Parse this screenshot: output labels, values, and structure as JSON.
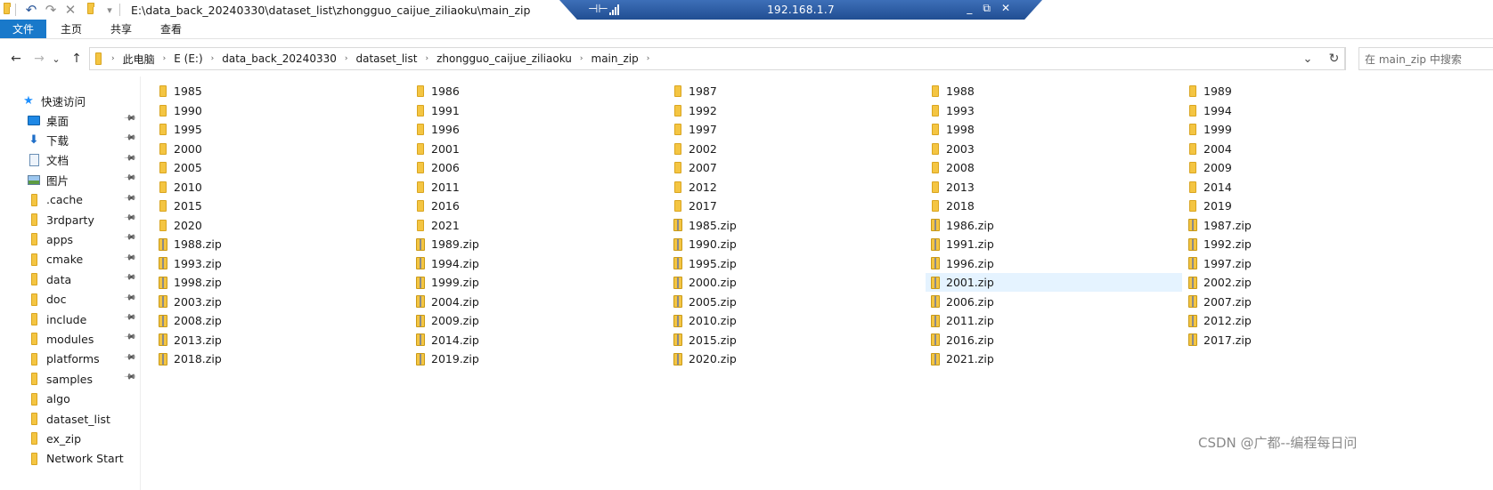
{
  "titlebar": {
    "path": "E:\\data_back_20240330\\dataset_list\\zhongguo_caijue_ziliaoku\\main_zip",
    "dropdown_glyph": "▾"
  },
  "remote": {
    "ip": "192.168.1.7",
    "pin_glyph": "⊣⊢",
    "controls": [
      "_",
      "⧉",
      "✕"
    ]
  },
  "ribbon": {
    "tabs": [
      "文件",
      "主页",
      "共享",
      "查看"
    ],
    "file_tab_color": "#1979ca"
  },
  "address": {
    "back": "←",
    "forward": "→",
    "recent": "⌄",
    "up": "↑",
    "crumbs": [
      "此电脑",
      "E (E:)",
      "data_back_20240330",
      "dataset_list",
      "zhongguo_caijue_ziliaoku",
      "main_zip"
    ],
    "separator": "›",
    "dropdown": "⌄",
    "refresh": "↻",
    "search_placeholder": "在 main_zip 中搜索"
  },
  "nav": {
    "quick_access": "快速访问",
    "items": [
      {
        "label": "桌面",
        "icon": "desktop-icon",
        "pinned": true
      },
      {
        "label": "下载",
        "icon": "download-icon",
        "pinned": true
      },
      {
        "label": "文档",
        "icon": "document-icon",
        "pinned": true
      },
      {
        "label": "图片",
        "icon": "picture-icon",
        "pinned": true
      },
      {
        "label": ".cache",
        "icon": "folder-icon",
        "pinned": true
      },
      {
        "label": "3rdparty",
        "icon": "folder-icon",
        "pinned": true
      },
      {
        "label": "apps",
        "icon": "folder-icon",
        "pinned": true
      },
      {
        "label": "cmake",
        "icon": "folder-icon",
        "pinned": true
      },
      {
        "label": "data",
        "icon": "folder-icon",
        "pinned": true
      },
      {
        "label": "doc",
        "icon": "folder-icon",
        "pinned": true
      },
      {
        "label": "include",
        "icon": "folder-icon",
        "pinned": true
      },
      {
        "label": "modules",
        "icon": "folder-icon",
        "pinned": true
      },
      {
        "label": "platforms",
        "icon": "folder-icon",
        "pinned": true
      },
      {
        "label": "samples",
        "icon": "folder-icon",
        "pinned": true
      },
      {
        "label": "algo",
        "icon": "folder-icon",
        "pinned": false
      },
      {
        "label": "dataset_list",
        "icon": "folder-icon",
        "pinned": false
      },
      {
        "label": "ex_zip",
        "icon": "folder-icon",
        "pinned": false
      },
      {
        "label": "Network Start",
        "icon": "folder-icon",
        "pinned": false
      }
    ],
    "pin_glyph": "📌"
  },
  "files": [
    "1985",
    "1986",
    "1987",
    "1988",
    "1989",
    "1990",
    "1991",
    "1992",
    "1993",
    "1994",
    "1995",
    "1996",
    "1997",
    "1998",
    "1999",
    "2000",
    "2001",
    "2002",
    "2003",
    "2004",
    "2005",
    "2006",
    "2007",
    "2008",
    "2009",
    "2010",
    "2011",
    "2012",
    "2013",
    "2014",
    "2015",
    "2016",
    "2017",
    "2018",
    "2019",
    "2020",
    "2021",
    "1985.zip",
    "1986.zip",
    "1987.zip",
    "1988.zip",
    "1989.zip",
    "1990.zip",
    "1991.zip",
    "1992.zip",
    "1993.zip",
    "1994.zip",
    "1995.zip",
    "1996.zip",
    "1997.zip",
    "1998.zip",
    "1999.zip",
    "2000.zip",
    "2001.zip",
    "2002.zip",
    "2003.zip",
    "2004.zip",
    "2005.zip",
    "2006.zip",
    "2007.zip",
    "2008.zip",
    "2009.zip",
    "2010.zip",
    "2011.zip",
    "2012.zip",
    "2013.zip",
    "2014.zip",
    "2015.zip",
    "2016.zip",
    "2017.zip",
    "2018.zip",
    "2019.zip",
    "2020.zip",
    "2021.zip"
  ],
  "selected_file": "2001.zip",
  "watermark": "CSDN @广都--编程每日问"
}
